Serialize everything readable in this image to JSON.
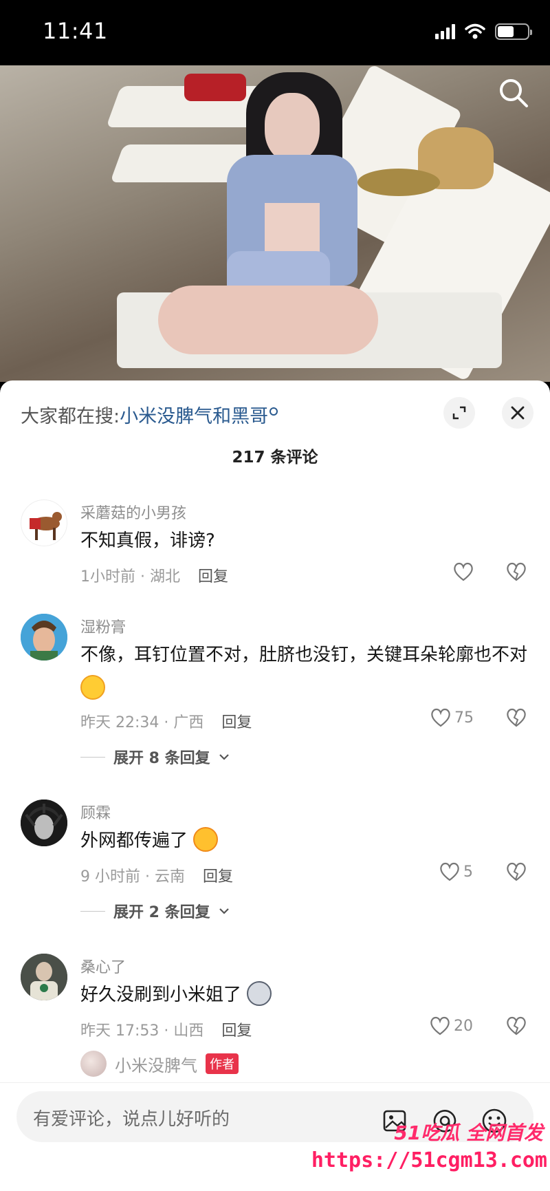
{
  "status_bar": {
    "time": "11:41"
  },
  "trending": {
    "prefix": "大家都在搜:",
    "keyword": "小米没脾气和黑哥"
  },
  "comment_count": "217 条评论",
  "comments": [
    {
      "user": "采蘑菇的小男孩",
      "text": "不知真假，诽谤?",
      "time_location": "1小时前 · 湖北",
      "reply_label": "回复",
      "likes": ""
    },
    {
      "user": "湿粉膏",
      "text": "不像，耳钉位置不对，肚脐也没钉，关键耳朵轮廓也不对",
      "time_location": "昨天 22:34 · 广西",
      "reply_label": "回复",
      "likes": "75",
      "expand": "展开 8 条回复"
    },
    {
      "user": "顾霖",
      "text": "外网都传遍了",
      "time_location": "9 小时前 · 云南",
      "reply_label": "回复",
      "likes": "5",
      "expand": "展开 2 条回复"
    },
    {
      "user": "桑心了",
      "text": "好久没刷到小米姐了",
      "time_location": "昨天 17:53 · 山西",
      "reply_label": "回复",
      "likes": "20"
    }
  ],
  "author_reply": {
    "user": "小米没脾气",
    "badge": "作者"
  },
  "input": {
    "placeholder": "有爱评论，说点儿好听的"
  },
  "watermark": {
    "brand": "51吃瓜 全网首发",
    "url": "https://51cgm13.com"
  },
  "colors": {
    "keyword": "#2a5a8f",
    "author_badge": "#e8334a",
    "watermark": "#ff1f63"
  },
  "icons": [
    "search-icon",
    "expand-icon",
    "close-icon",
    "heart-icon",
    "broken-heart-icon",
    "chevron-down-icon",
    "image-icon",
    "at-icon",
    "emoji-icon"
  ]
}
